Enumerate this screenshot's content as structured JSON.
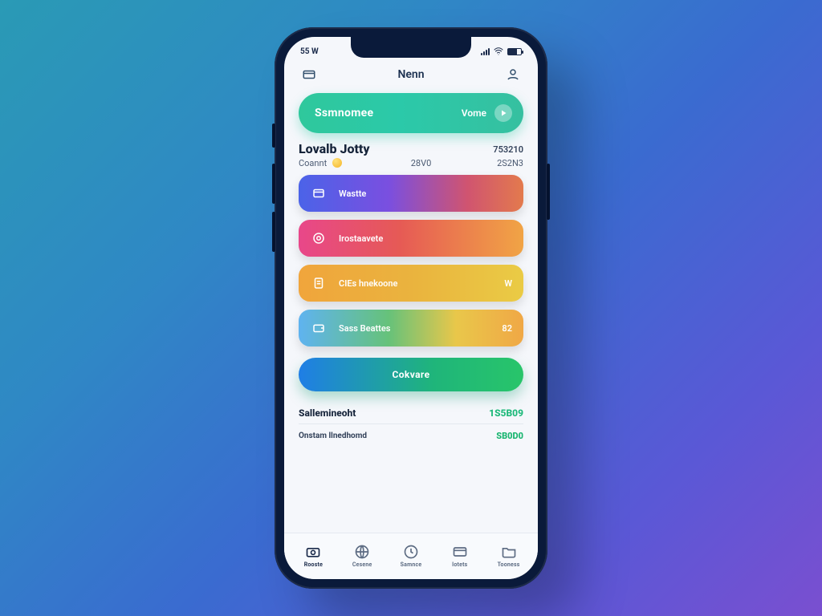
{
  "status": {
    "time": "55 W"
  },
  "header": {
    "title": "Nenn"
  },
  "segmented": {
    "left_label": "Ssmnomee",
    "right_label": "Vome"
  },
  "loyalty": {
    "title": "Lovalb Jotty",
    "right_value": "753210",
    "row2_label": "Coannt",
    "row2_mid": "28V0",
    "row2_right": "2S2N3"
  },
  "cards": [
    {
      "label": "Wastte",
      "trailing": ""
    },
    {
      "label": "Irostaavete",
      "trailing": ""
    },
    {
      "label": "CIEs hnekoone",
      "trailing": "W"
    },
    {
      "label": "Sass Beattes",
      "trailing": "82"
    }
  ],
  "cta": {
    "label": "Cokvare"
  },
  "statement": {
    "heading": "Sallemineoht",
    "heading_value": "1S5B09",
    "sub_label": "Onstam llnedhomd",
    "sub_value": "SB0D0"
  },
  "tabs": [
    {
      "label": "Rooste"
    },
    {
      "label": "Cesene"
    },
    {
      "label": "Samnce"
    },
    {
      "label": "Iotets"
    },
    {
      "label": "Tooness"
    }
  ]
}
